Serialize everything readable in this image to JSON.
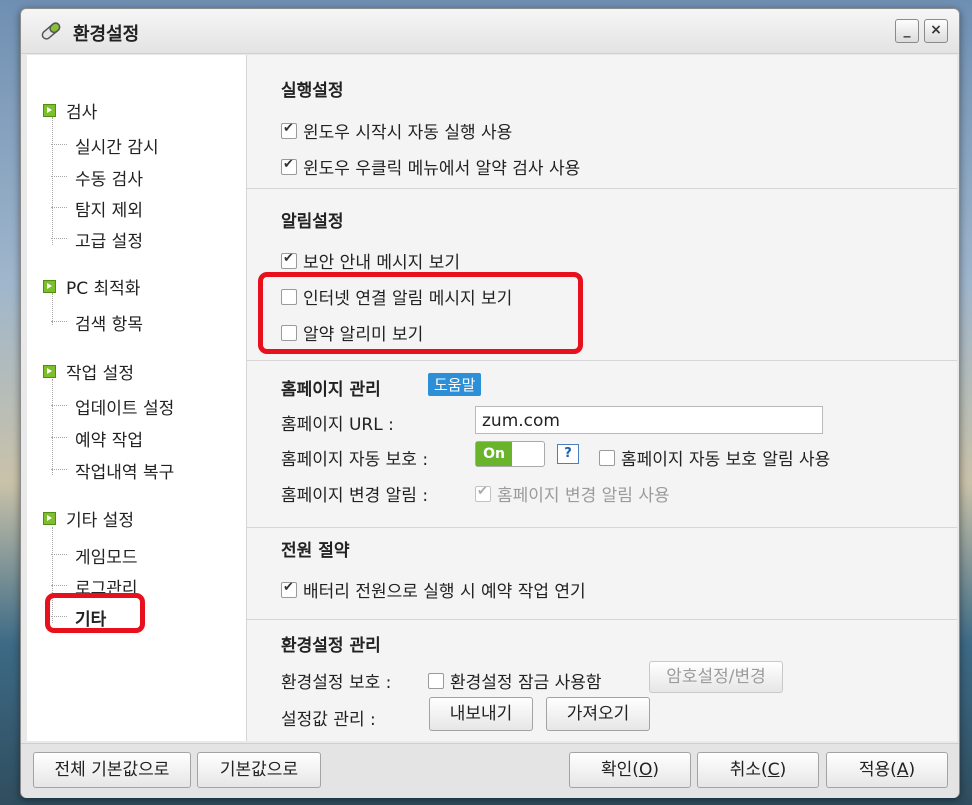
{
  "window": {
    "title": "환경설정",
    "minimize_label": "_",
    "close_label": "×"
  },
  "sidebar": {
    "groups": [
      {
        "label": "검사",
        "items": [
          "실시간 감시",
          "수동 검사",
          "탐지 제외",
          "고급 설정"
        ]
      },
      {
        "label": "PC 최적화",
        "items": [
          "검색 항목"
        ]
      },
      {
        "label": "작업 설정",
        "items": [
          "업데이트 설정",
          "예약 작업",
          "작업내역 복구"
        ]
      },
      {
        "label": "기타 설정",
        "items": [
          "게임모드",
          "로그관리",
          "기타"
        ]
      }
    ],
    "selected": "기타"
  },
  "run_settings": {
    "title": "실행설정",
    "options": [
      {
        "label": "윈도우 시작시 자동 실행 사용",
        "checked": true
      },
      {
        "label": "윈도우 우클릭 메뉴에서 알약 검사 사용",
        "checked": true
      }
    ]
  },
  "notify_settings": {
    "title": "알림설정",
    "options": [
      {
        "label": "보안 안내 메시지 보기",
        "checked": true
      },
      {
        "label": "인터넷 연결 알림 메시지 보기",
        "checked": false
      },
      {
        "label": "알약 알리미 보기",
        "checked": false
      }
    ]
  },
  "homepage": {
    "title": "홈페이지 관리",
    "help_label": "도움말",
    "url_label": "홈페이지 URL :",
    "url_value": "zum.com",
    "protect_label": "홈페이지 자동 보호 :",
    "toggle_label": "On",
    "help_icon": "?",
    "protect_alert_label": "홈페이지 자동 보호 알림 사용",
    "change_label": "홈페이지 변경 알림 :",
    "change_check_label": "홈페이지 변경 알림 사용"
  },
  "power": {
    "title": "전원 절약",
    "option": "배터리 전원으로 실행 시 예약 작업 연기"
  },
  "config_manage": {
    "title": "환경설정 관리",
    "protect_label": "환경설정 보호 :",
    "lock_label": "환경설정 잠금 사용함",
    "password_button": "암호설정/변경",
    "value_label": "설정값 관리 :",
    "export_button": "내보내기",
    "import_button": "가져오기"
  },
  "footer": {
    "reset_all": "전체 기본값으로",
    "reset": "기본값으로",
    "ok_text": "확인(",
    "ok_key": "O",
    "cancel_text": "취소(",
    "cancel_key": "C",
    "apply_text": "적용(",
    "apply_key": "A",
    "paren_close": ")"
  },
  "colors": {
    "highlight": "#e8101c",
    "accent_green": "#6ab42c",
    "help_blue": "#2c8fd8"
  }
}
